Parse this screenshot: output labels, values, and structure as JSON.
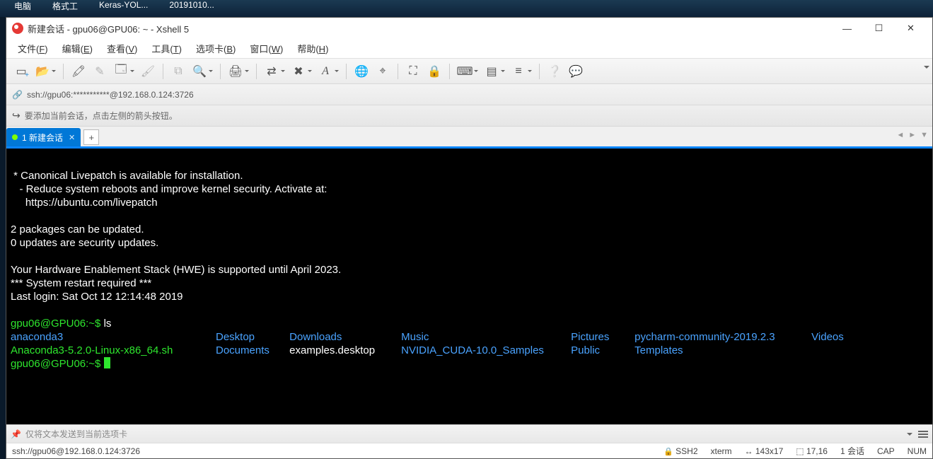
{
  "desktop": {
    "icons": [
      "电脑",
      "格式工",
      "Keras-YOL...",
      "20191010..."
    ]
  },
  "window": {
    "title": "新建会话 - gpu06@GPU06: ~ - Xshell 5",
    "menus": {
      "file": "文件(",
      "file_u": "F",
      "edit": "编辑(",
      "edit_u": "E",
      "view": "查看(",
      "view_u": "V",
      "tools": "工具(",
      "tools_u": "T",
      "tabs": "选项卡(",
      "tabs_u": "B",
      "window": "窗口(",
      "window_u": "W",
      "help": "帮助(",
      "help_u": "H"
    },
    "address": "ssh://gpu06:***********@192.168.0.124:3726",
    "hint": "要添加当前会话，点击左侧的箭头按钮。",
    "tab_label": "1 新建会话",
    "send_placeholder": "仅将文本发送到当前选项卡"
  },
  "terminal": {
    "l1": " * Canonical Livepatch is available for installation.",
    "l2": "   - Reduce system reboots and improve kernel security. Activate at:",
    "l3": "     https://ubuntu.com/livepatch",
    "l4": "2 packages can be updated.",
    "l5": "0 updates are security updates.",
    "l6": "Your Hardware Enablement Stack (HWE) is supported until April 2023.",
    "l7": "*** System restart required ***",
    "l8": "Last login: Sat Oct 12 12:14:48 2019",
    "prompt1": "gpu06@GPU06:~$ ",
    "cmd1": "ls",
    "ls_row1": {
      "c1": "anaconda3",
      "c2": "Desktop",
      "c3": "Downloads",
      "c4": "Music",
      "c5": "Pictures",
      "c6": "pycharm-community-2019.2.3",
      "c7": "Videos"
    },
    "ls_row2": {
      "c1": "Anaconda3-5.2.0-Linux-x86_64.sh",
      "c2": "Documents",
      "c3": "examples.desktop",
      "c4": "NVIDIA_CUDA-10.0_Samples",
      "c5": "Public",
      "c6": "Templates"
    },
    "prompt2": "gpu06@GPU06:~$ "
  },
  "status": {
    "addr": "ssh://gpu06@192.168.0.124:3726",
    "proto": "SSH2",
    "term": "xterm",
    "size": "143x17",
    "pos": "17,16",
    "sess": "1 会话",
    "cap": "CAP",
    "num": "NUM"
  }
}
